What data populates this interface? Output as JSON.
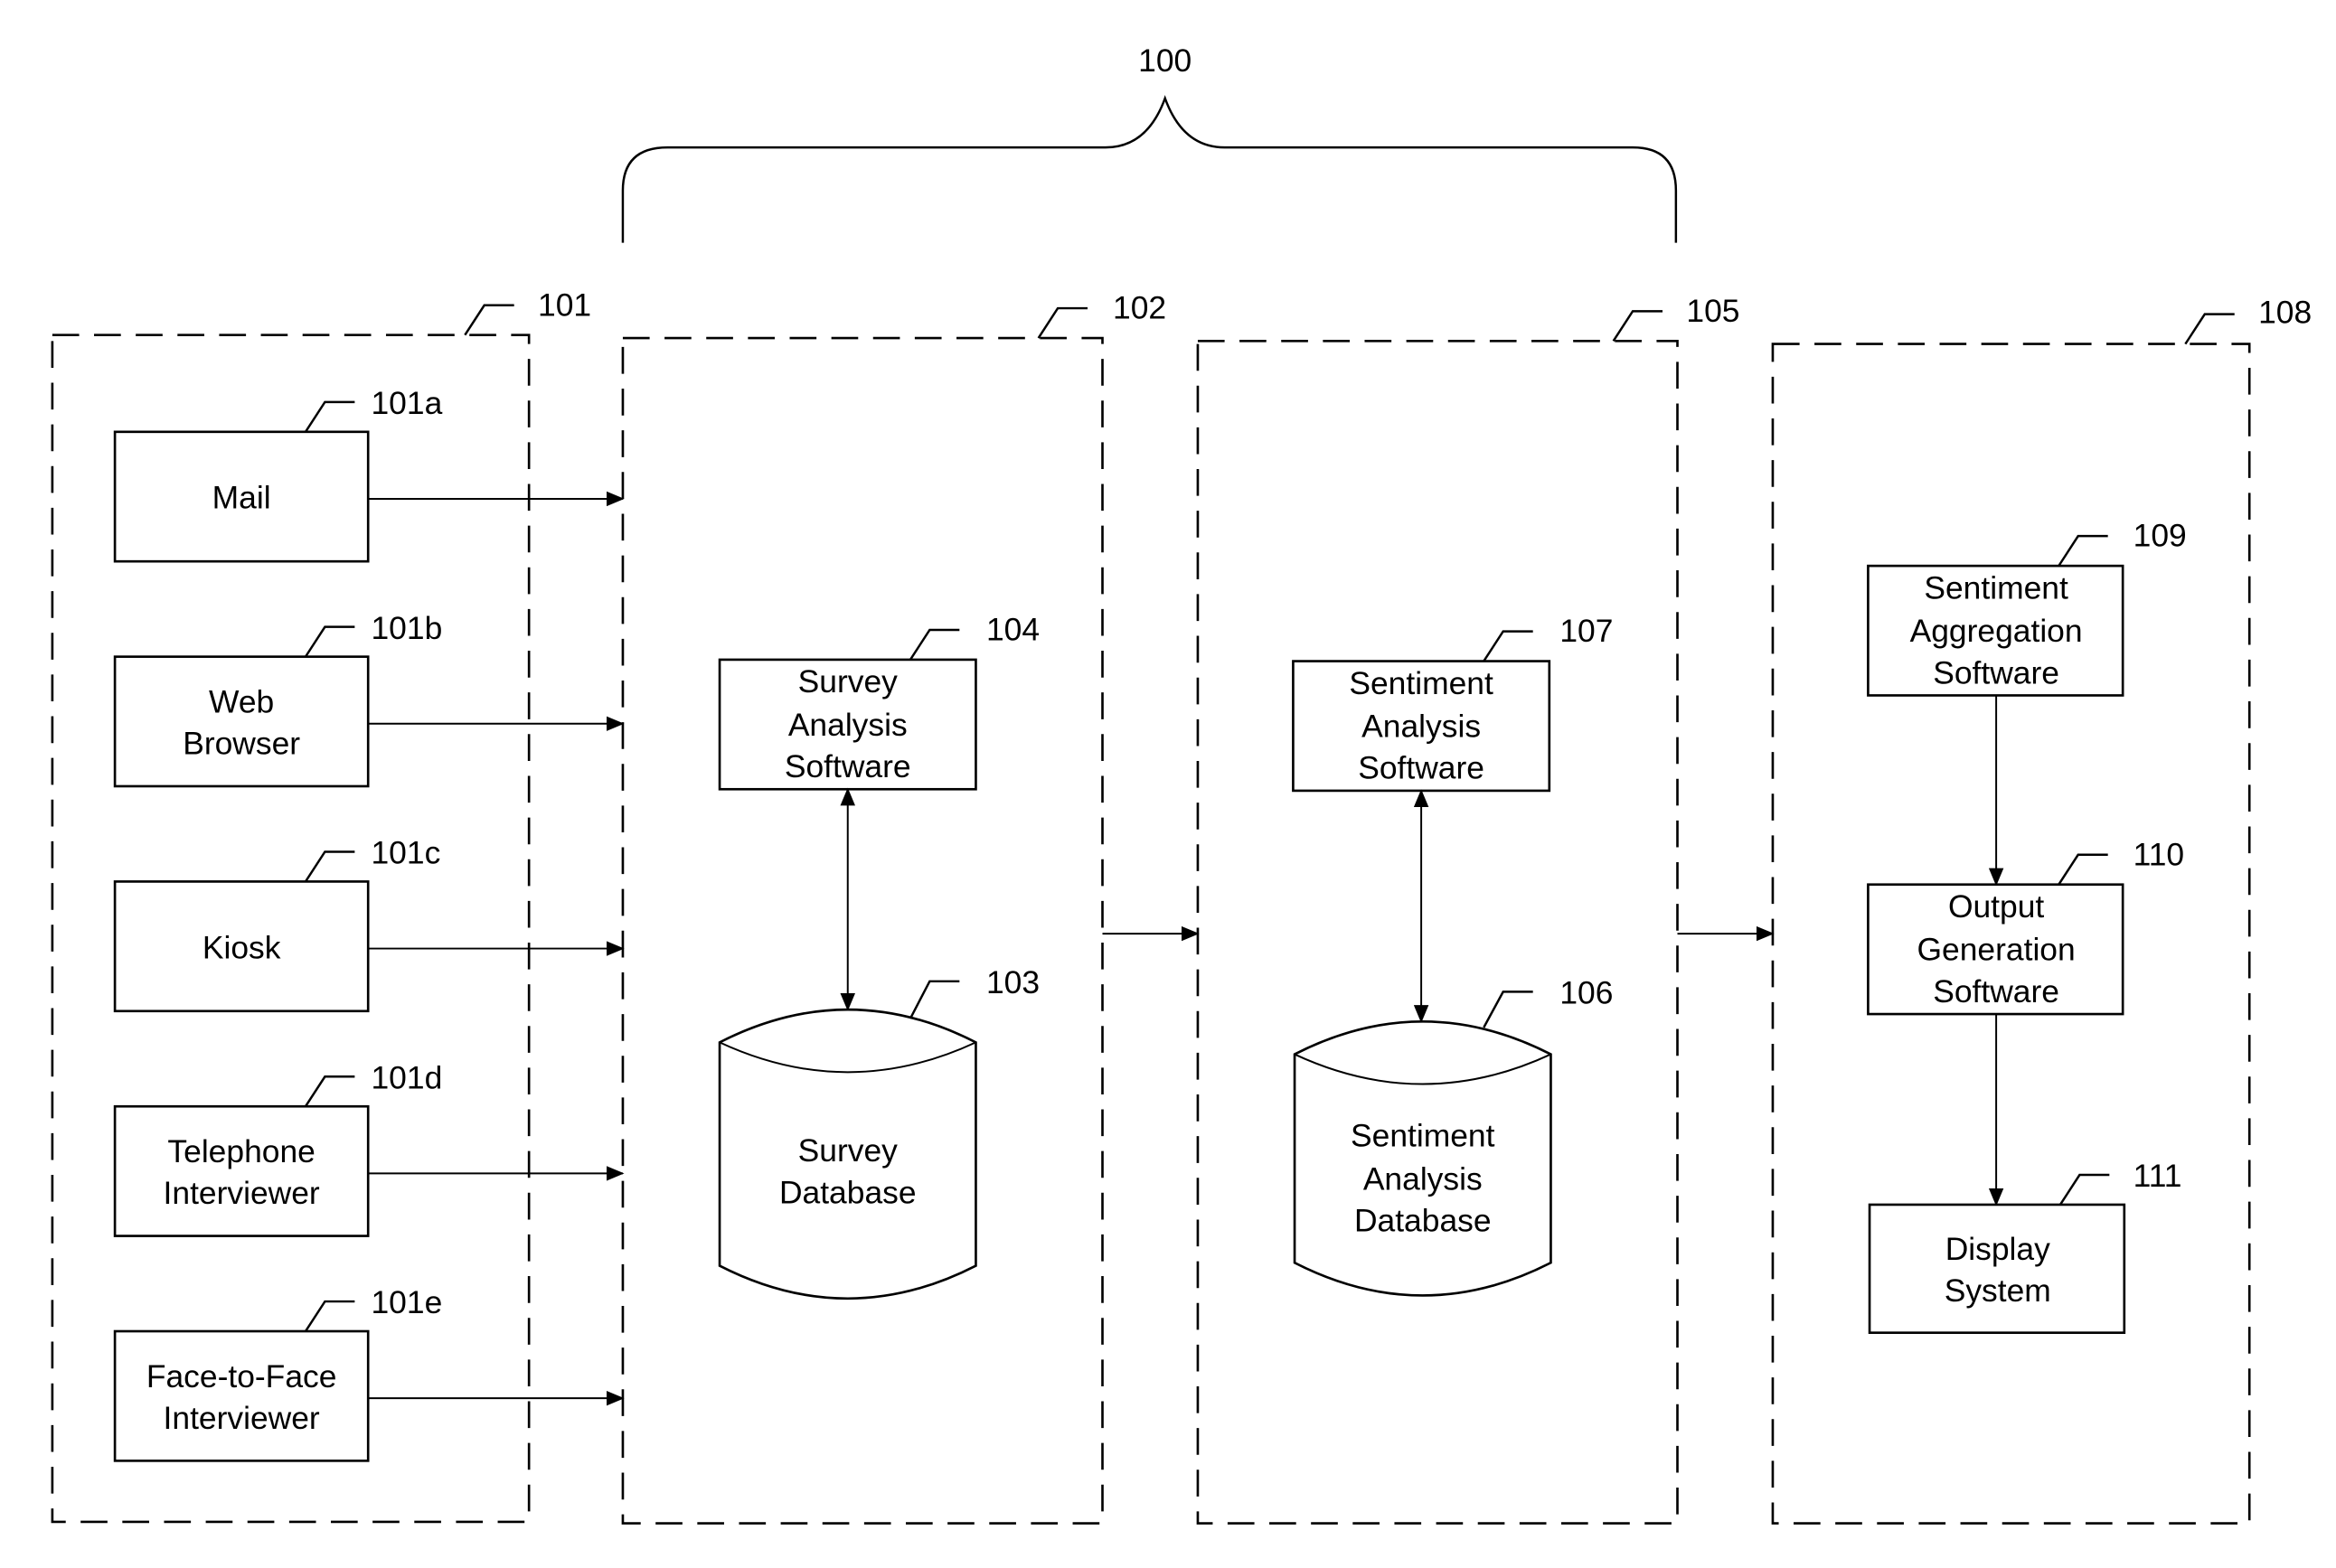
{
  "system": {
    "ref": "100"
  },
  "groups": [
    {
      "id": "input",
      "ref": "101"
    },
    {
      "id": "survey-analysis",
      "ref": "102"
    },
    {
      "id": "sentiment-analysis",
      "ref": "105"
    },
    {
      "id": "output",
      "ref": "108"
    }
  ],
  "inputs": [
    {
      "ref": "101a",
      "lines": [
        "Mail"
      ]
    },
    {
      "ref": "101b",
      "lines": [
        "Web",
        "Browser"
      ]
    },
    {
      "ref": "101c",
      "lines": [
        "Kiosk"
      ]
    },
    {
      "ref": "101d",
      "lines": [
        "Telephone",
        "Interviewer"
      ]
    },
    {
      "ref": "101e",
      "lines": [
        "Face-to-Face",
        "Interviewer"
      ]
    }
  ],
  "survey_software": {
    "ref": "104",
    "lines": [
      "Survey",
      "Analysis",
      "Software"
    ]
  },
  "survey_db": {
    "ref": "103",
    "lines": [
      "Survey",
      "Database"
    ]
  },
  "sentiment_software": {
    "ref": "107",
    "lines": [
      "Sentiment",
      "Analysis",
      "Software"
    ]
  },
  "sentiment_db": {
    "ref": "106",
    "lines": [
      "Sentiment",
      "Analysis",
      "Database"
    ]
  },
  "aggregation": {
    "ref": "109",
    "lines": [
      "Sentiment",
      "Aggregation",
      "Software"
    ]
  },
  "output_gen": {
    "ref": "110",
    "lines": [
      "Output",
      "Generation",
      "Software"
    ]
  },
  "display": {
    "ref": "111",
    "lines": [
      "Display",
      "System"
    ]
  }
}
